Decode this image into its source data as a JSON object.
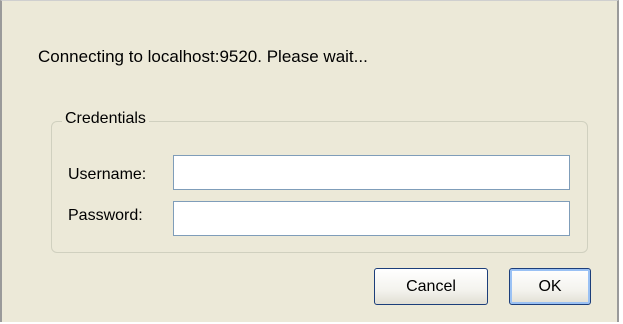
{
  "dialog": {
    "message": "Connecting to localhost:9520. Please wait..."
  },
  "credentials": {
    "legend": "Credentials",
    "username_label": "Username:",
    "username_value": "",
    "password_label": "Password:",
    "password_value": ""
  },
  "buttons": {
    "cancel_label": "Cancel",
    "ok_label": "OK"
  },
  "colors": {
    "dialog_background": "#ece9d8",
    "input_border": "#7f9db9",
    "button_border": "#1c3e7a",
    "default_button_focus": "#9ac1f4"
  }
}
